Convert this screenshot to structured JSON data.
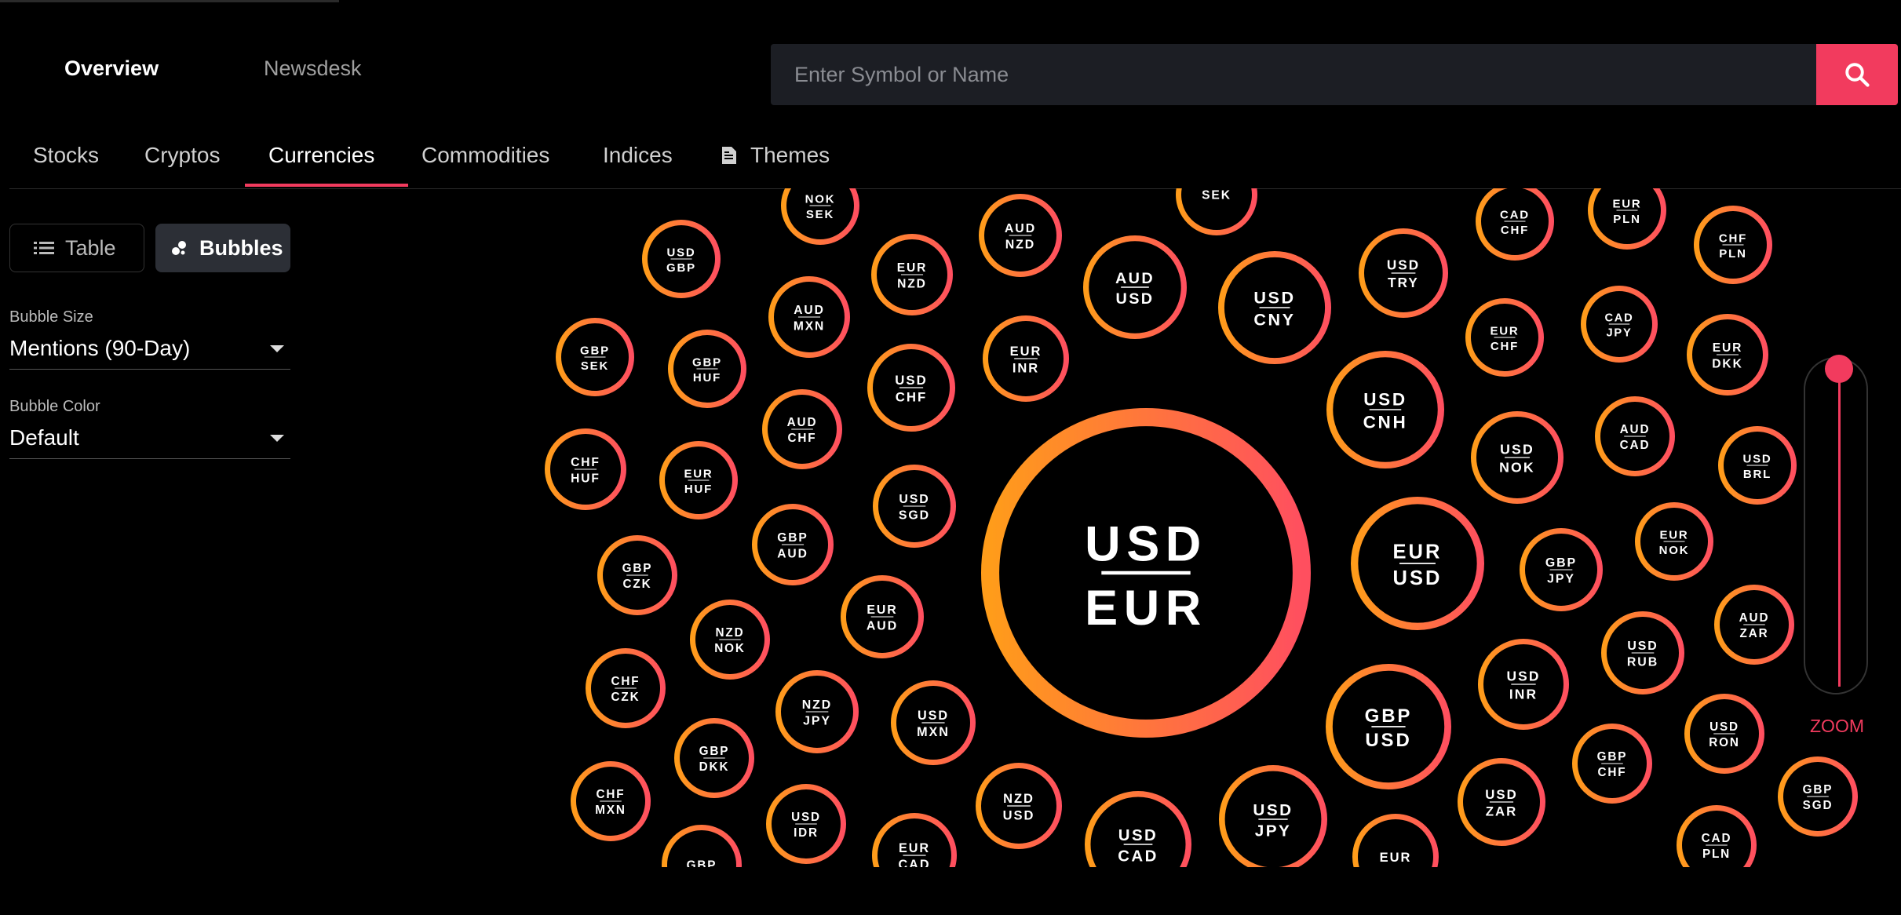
{
  "nav": {
    "overview": "Overview",
    "newsdesk": "Newsdesk"
  },
  "search": {
    "placeholder": "Enter Symbol or Name"
  },
  "tabs": [
    "Stocks",
    "Cryptos",
    "Currencies",
    "Commodities",
    "Indices",
    "Themes"
  ],
  "active_tab": "Currencies",
  "view_toggle": {
    "table": "Table",
    "bubbles": "Bubbles",
    "selected": "Bubbles"
  },
  "controls": {
    "bubble_size_label": "Bubble Size",
    "bubble_size_value": "Mentions (90-Day)",
    "bubble_color_label": "Bubble Color",
    "bubble_color_value": "Default"
  },
  "zoom_label": "ZOOM",
  "colors": {
    "accent": "#f23b5e",
    "gradient_start": "#ff9c1a",
    "gradient_end": "#ff4f5f"
  },
  "bubbles": [
    [
      "USD",
      "EUR"
    ],
    [
      "USD",
      "GBP"
    ],
    [
      "NOK",
      "SEK"
    ],
    [
      "AUD",
      "NZD"
    ],
    [
      "SEK",
      ""
    ],
    [
      "CAD",
      "CHF"
    ],
    [
      "EUR",
      "PLN"
    ],
    [
      "CHF",
      "PLN"
    ],
    [
      "EUR",
      "NZD"
    ],
    [
      "AUD",
      "USD"
    ],
    [
      "USD",
      "CNY"
    ],
    [
      "USD",
      "TRY"
    ],
    [
      "GBP",
      "SEK"
    ],
    [
      "GBP",
      "HUF"
    ],
    [
      "AUD",
      "MXN"
    ],
    [
      "EUR",
      "INR"
    ],
    [
      "EUR",
      "CHF"
    ],
    [
      "CAD",
      "JPY"
    ],
    [
      "EUR",
      "DKK"
    ],
    [
      "USD",
      "CHF"
    ],
    [
      "USD",
      "CNH"
    ],
    [
      "CHF",
      "HUF"
    ],
    [
      "EUR",
      "HUF"
    ],
    [
      "AUD",
      "CHF"
    ],
    [
      "USD",
      "NOK"
    ],
    [
      "AUD",
      "CAD"
    ],
    [
      "USD",
      "BRL"
    ],
    [
      "USD",
      "SGD"
    ],
    [
      "GBP",
      "AUD"
    ],
    [
      "EUR",
      "USD"
    ],
    [
      "GBP",
      "JPY"
    ],
    [
      "EUR",
      "NOK"
    ],
    [
      "GBP",
      "CZK"
    ],
    [
      "EUR",
      "AUD"
    ],
    [
      "NZD",
      "NOK"
    ],
    [
      "AUD",
      "ZAR"
    ],
    [
      "USD",
      "RUB"
    ],
    [
      "USD",
      "INR"
    ],
    [
      "CHF",
      "CZK"
    ],
    [
      "NZD",
      "JPY"
    ],
    [
      "USD",
      "MXN"
    ],
    [
      "GBP",
      "USD"
    ],
    [
      "GBP",
      "DKK"
    ],
    [
      "USD",
      "RON"
    ],
    [
      "GBP",
      "CHF"
    ],
    [
      "CHF",
      "MXN"
    ],
    [
      "NZD",
      "USD"
    ],
    [
      "USD",
      "ZAR"
    ],
    [
      "GBP",
      "SGD"
    ],
    [
      "USD",
      "IDR"
    ],
    [
      "USD",
      "JPY"
    ],
    [
      "CAD",
      "PLN"
    ],
    [
      "EUR",
      "CAD"
    ],
    [
      "USD",
      "CAD"
    ],
    [
      "GBP",
      ""
    ],
    [
      "EUR",
      ""
    ]
  ]
}
